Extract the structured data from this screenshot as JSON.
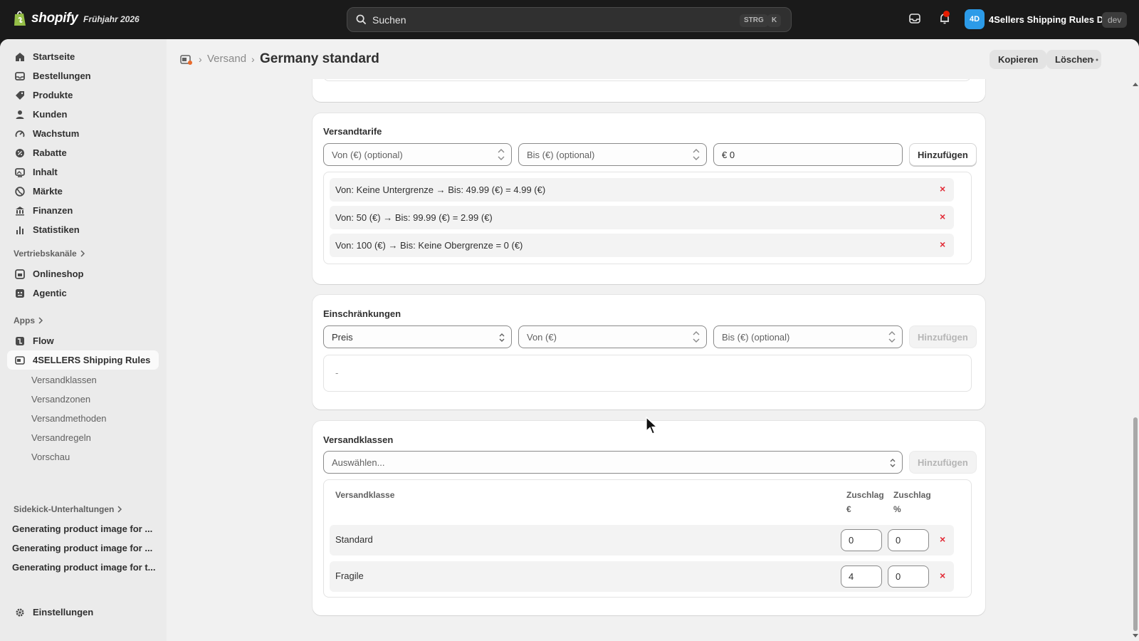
{
  "topbar": {
    "brand": "shopify",
    "edition": "Frühjahr 2026",
    "search_placeholder": "Suchen",
    "shortcut_mod": "STRG",
    "shortcut_key": "K",
    "store_initials": "4D",
    "store_name": "4Sellers Shipping Rules D...",
    "env_badge": "dev"
  },
  "sidebar": {
    "items": [
      {
        "label": "Startseite",
        "icon": "home-icon"
      },
      {
        "label": "Bestellungen",
        "icon": "orders-icon"
      },
      {
        "label": "Produkte",
        "icon": "tag-icon"
      },
      {
        "label": "Kunden",
        "icon": "person-icon"
      },
      {
        "label": "Wachstum",
        "icon": "gauge-icon"
      },
      {
        "label": "Rabatte",
        "icon": "discount-icon"
      },
      {
        "label": "Inhalt",
        "icon": "content-icon"
      },
      {
        "label": "Märkte",
        "icon": "globe-icon"
      },
      {
        "label": "Finanzen",
        "icon": "bank-icon"
      },
      {
        "label": "Statistiken",
        "icon": "chart-icon"
      }
    ],
    "sales_channels_label": "Vertriebskanäle",
    "sales_channels": [
      {
        "label": "Onlineshop",
        "icon": "store-icon"
      },
      {
        "label": "Agentic",
        "icon": "agent-icon"
      }
    ],
    "apps_label": "Apps",
    "apps": [
      {
        "label": "Flow",
        "icon": "flow-icon"
      },
      {
        "label": "4SELLERS Shipping Rules",
        "icon": "app-icon"
      }
    ],
    "app_subitems": [
      "Versandklassen",
      "Versandzonen",
      "Versandmethoden",
      "Versandregeln",
      "Vorschau"
    ],
    "sidekick_label": "Sidekick-Unterhaltungen",
    "sidekick_chats": [
      "Generating product image for ...",
      "Generating product image for ...",
      "Generating product image for t..."
    ],
    "settings_label": "Einstellungen"
  },
  "header": {
    "breadcrumb_prev": "Versand",
    "title": "Germany standard",
    "copy_label": "Kopieren",
    "delete_label": "Löschen"
  },
  "rates": {
    "title": "Versandtarife",
    "from_placeholder": "Von (€) (optional)",
    "to_placeholder": "Bis (€) (optional)",
    "price_value": "€ 0",
    "add_label": "Hinzufügen",
    "rows": [
      "Von: Keine Untergrenze → Bis: 49.99 (€) = 4.99 (€)",
      "Von: 50 (€) → Bis: 99.99 (€) = 2.99 (€)",
      "Von: 100 (€) → Bis: Keine Obergrenze = 0 (€)"
    ],
    "remove_symbol": "×"
  },
  "restrictions": {
    "title": "Einschränkungen",
    "type_value": "Preis",
    "from_placeholder": "Von (€)",
    "to_placeholder": "Bis (€) (optional)",
    "add_label": "Hinzufügen",
    "empty_text": "-"
  },
  "classes": {
    "title": "Versandklassen",
    "select_placeholder": "Auswählen...",
    "add_label": "Hinzufügen",
    "col_class": "Versandklasse",
    "col_surcharge_eur_1": "Zuschlag",
    "col_surcharge_eur_2": "€",
    "col_surcharge_pct_1": "Zuschlag",
    "col_surcharge_pct_2": "%",
    "rows": [
      {
        "name": "Standard",
        "eur": "0",
        "pct": "0"
      },
      {
        "name": "Fragile",
        "eur": "4",
        "pct": "0"
      }
    ],
    "remove_symbol": "×"
  },
  "colors": {
    "topbar_bg": "#1a1a1a",
    "frame_bg": "#ebebeb",
    "content_bg": "#f1f1f1",
    "danger": "#e22c38",
    "avatar": "#2c9be8"
  }
}
